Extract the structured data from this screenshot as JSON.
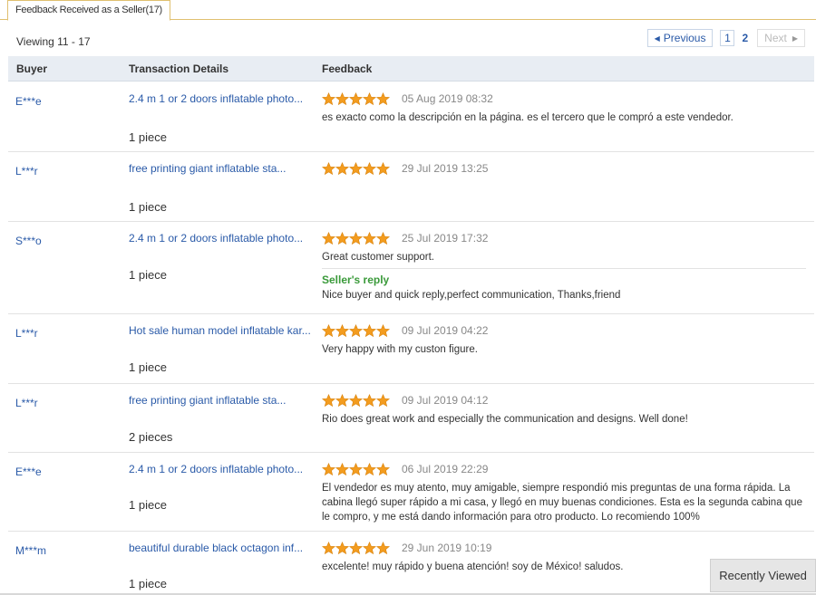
{
  "tab": {
    "label": "Feedback Received as a Seller(17)"
  },
  "viewing": "Viewing 11 - 17",
  "pager": {
    "previous": "Previous",
    "page1": "1",
    "page2": "2",
    "next": "Next"
  },
  "columns": {
    "buyer": "Buyer",
    "transaction": "Transaction Details",
    "feedback": "Feedback"
  },
  "rows": [
    {
      "buyer": "E***e",
      "title": "2.4 m 1 or 2 doors inflatable photo...",
      "qty": "1 piece",
      "stars": 5,
      "date": "05 Aug 2019 08:32",
      "text": "es exacto como la descripción en la página. es el tercero que le compró a este vendedor."
    },
    {
      "buyer": "L***r",
      "title": "free printing giant inflatable sta...",
      "qty": "1 piece",
      "stars": 5,
      "date": "29 Jul 2019 13:25",
      "text": ""
    },
    {
      "buyer": "S***o",
      "title": "2.4 m 1 or 2 doors inflatable photo...",
      "qty": "1 piece",
      "stars": 5,
      "date": "25 Jul 2019 17:32",
      "text": "Great customer support.",
      "reply_label": "Seller's reply",
      "reply_text": "Nice buyer and quick reply,perfect communication, Thanks,friend"
    },
    {
      "buyer": "L***r",
      "title": "Hot sale human model inflatable kar...",
      "qty": "1 piece",
      "stars": 5,
      "date": "09 Jul 2019 04:22",
      "text": "Very happy with my custon figure."
    },
    {
      "buyer": "L***r",
      "title": "free printing giant inflatable sta...",
      "qty": "2 pieces",
      "stars": 5,
      "date": "09 Jul 2019 04:12",
      "text": "Rio does great work and especially the communication and designs. Well done!"
    },
    {
      "buyer": "E***e",
      "title": "2.4 m 1 or 2 doors inflatable photo...",
      "qty": "1 piece",
      "stars": 5,
      "date": "06 Jul 2019 22:29",
      "text": "El vendedor es muy atento, muy amigable, siempre respondió mis preguntas de una forma rápida. La cabina llegó super rápido a mi casa, y llegó en muy buenas condiciones. Esta es la segunda cabina que le compro, y me está dando información para otro producto. Lo recomiendo 100%"
    },
    {
      "buyer": "M***m",
      "title": "beautiful durable black octagon inf...",
      "qty": "1 piece",
      "stars": 5,
      "date": "29 Jun 2019 10:19",
      "text": "excelente! muy rápido y buena atención! soy de México! saludos."
    }
  ],
  "recently_viewed": "Recently Viewed",
  "colors": {
    "link": "#2a5aa8",
    "star": "#f39c1f",
    "reply": "#3a9a3a",
    "header_bg": "#e8edf3"
  }
}
